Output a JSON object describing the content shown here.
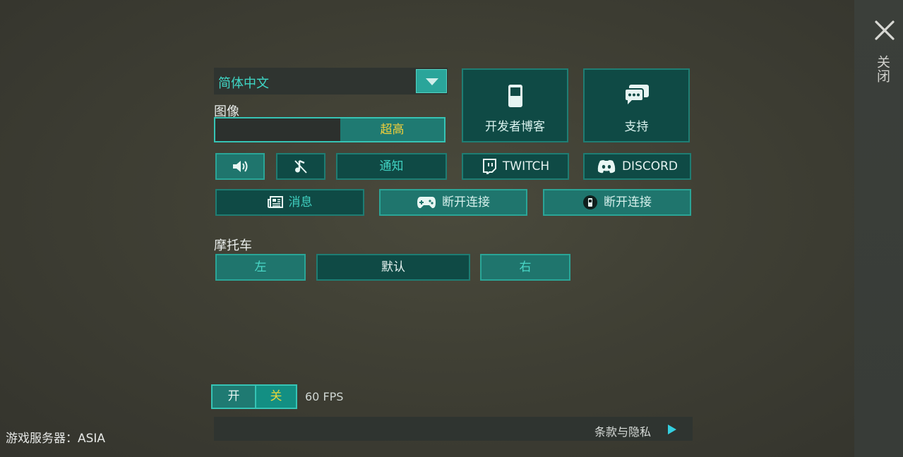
{
  "close": {
    "label": "关闭"
  },
  "language": {
    "selected": "简体中文"
  },
  "graphics": {
    "label": "图像",
    "value": "超高"
  },
  "tiles": {
    "dev_blog": "开发者博客",
    "support": "支持"
  },
  "row1": {
    "notice": "通知",
    "twitch": "TWITCH",
    "discord": "DISCORD"
  },
  "row2": {
    "news": "消息",
    "disconnect_gamepad": "断开连接",
    "disconnect_device": "断开连接"
  },
  "motorcycle": {
    "label": "摩托车",
    "left": "左",
    "default": "默认",
    "right": "右"
  },
  "fps": {
    "on": "开",
    "off": "关",
    "value": "60 FPS"
  },
  "terms": {
    "label": "条款与隐私"
  },
  "server": {
    "label": "游戏服务器：ASIA"
  },
  "colors": {
    "accent": "#36c4b5",
    "panel": "#0f4a45",
    "highlight": "#f0cf3a"
  }
}
